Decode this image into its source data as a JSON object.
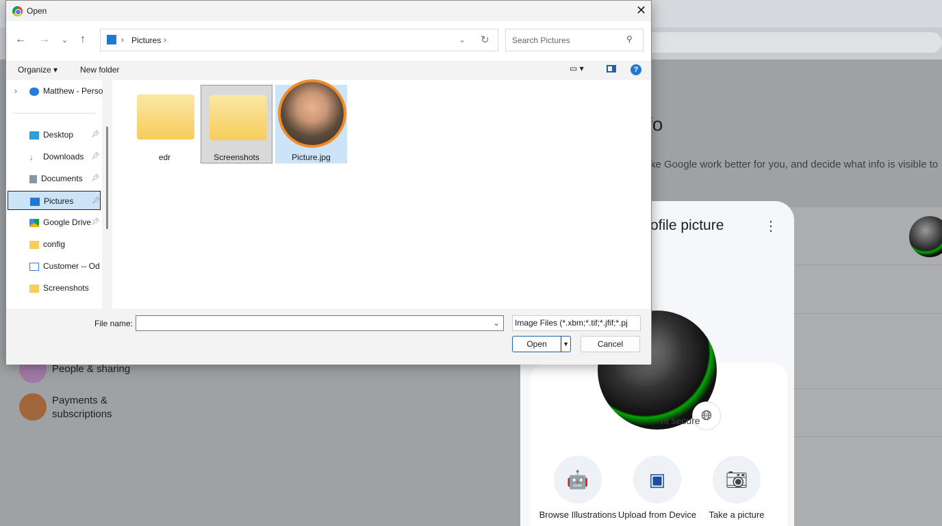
{
  "page": {
    "heading_fragment": "fo",
    "description_fragment": "ke Google work better for you, and decide what info is visible to",
    "nav": [
      {
        "label": "People & sharing",
        "color": "#a07aa5"
      },
      {
        "label": "Payments & subscriptions",
        "color": "#a0663a"
      }
    ],
    "security_fragment": "nt secure"
  },
  "profile_card": {
    "title_fragment": "ofile picture",
    "options": [
      {
        "label": "Browse Illustrations",
        "icon": "robot-illustration-icon"
      },
      {
        "label": "Upload from Device",
        "icon": "photo-library-icon"
      },
      {
        "label": "Take a picture",
        "icon": "camera-icon"
      }
    ]
  },
  "dialog": {
    "title": "Open",
    "path": [
      "Pictures"
    ],
    "search_placeholder": "Search Pictures",
    "toolbar": {
      "organize": "Organize",
      "new_folder": "New folder"
    },
    "sidebar": [
      {
        "label": "Matthew - Perso",
        "icon": "onedrive-icon"
      },
      {
        "label": "Desktop",
        "icon": "desktop-icon",
        "pinned": true
      },
      {
        "label": "Downloads",
        "icon": "download-icon",
        "pinned": true
      },
      {
        "label": "Documents",
        "icon": "documents-icon",
        "pinned": true
      },
      {
        "label": "Pictures",
        "icon": "pictures-icon",
        "pinned": true,
        "selected": true
      },
      {
        "label": "Google Drive",
        "icon": "google-drive-icon",
        "pinned": true
      },
      {
        "label": "config",
        "icon": "folder-icon"
      },
      {
        "label": "Customer -- Od",
        "icon": "contact-icon"
      },
      {
        "label": "Screenshots",
        "icon": "folder-icon"
      }
    ],
    "files": [
      {
        "name": "edr",
        "type": "folder"
      },
      {
        "name": "Screenshots",
        "type": "folder",
        "hovered": true
      },
      {
        "name": "Picture.jpg",
        "type": "image",
        "selected": true
      }
    ],
    "file_name_label": "File name:",
    "file_name_value": "",
    "file_type": "Image Files (*.xbm;*.tif;*.jfif;*.pj",
    "open": "Open",
    "cancel": "Cancel",
    "highlight_color": "#f28c28"
  }
}
